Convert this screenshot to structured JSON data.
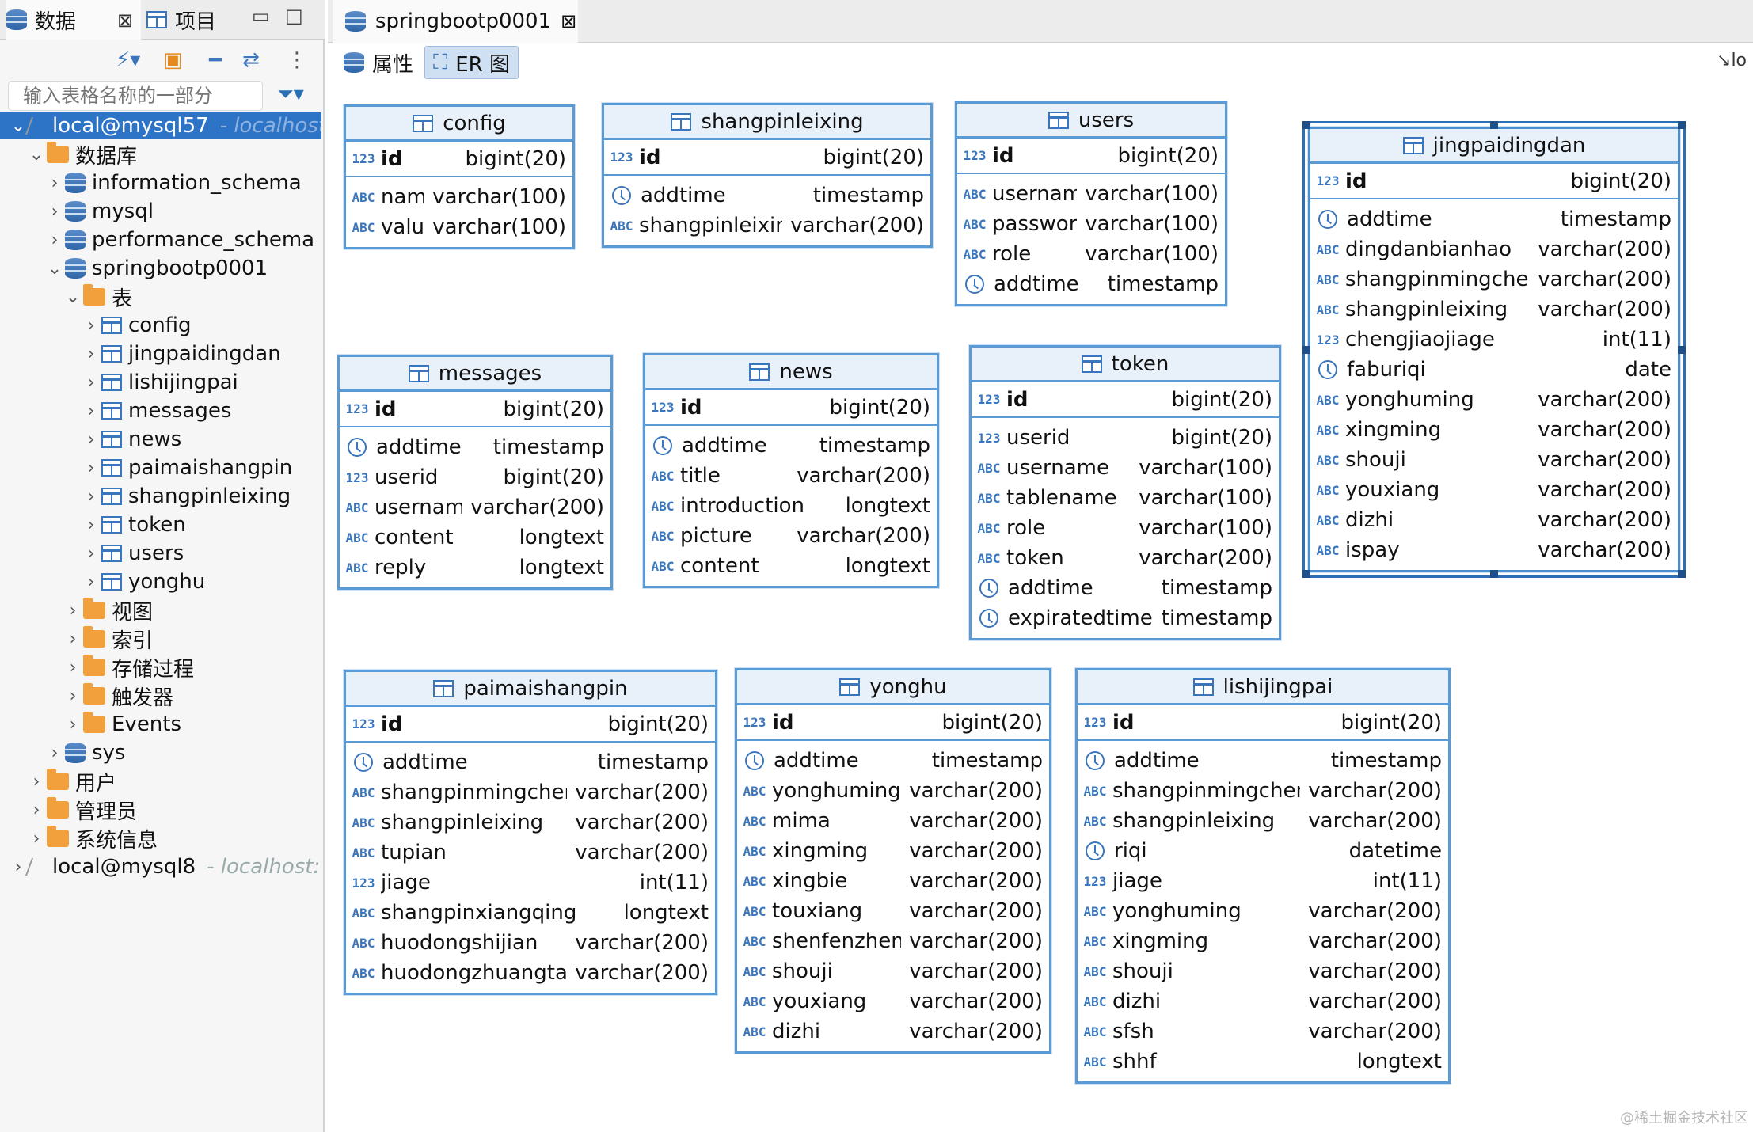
{
  "left_panel": {
    "tab_data_label": "数据",
    "tab_project_label": "项目",
    "filter_placeholder": "输入表格名称的一部分",
    "tree": [
      {
        "label": "local@mysql57",
        "extra": "- localhost",
        "level": 0,
        "expanded": true,
        "icon": "connection",
        "selected": true
      },
      {
        "label": "数据库",
        "level": 1,
        "expanded": true,
        "icon": "database-group"
      },
      {
        "label": "information_schema",
        "level": 2,
        "expanded": false,
        "icon": "database"
      },
      {
        "label": "mysql",
        "level": 2,
        "expanded": false,
        "icon": "database"
      },
      {
        "label": "performance_schema",
        "level": 2,
        "expanded": false,
        "icon": "database"
      },
      {
        "label": "springbootp0001",
        "level": 2,
        "expanded": true,
        "icon": "database"
      },
      {
        "label": "表",
        "level": 3,
        "expanded": true,
        "icon": "table-group"
      },
      {
        "label": "config",
        "level": 4,
        "expanded": false,
        "icon": "table"
      },
      {
        "label": "jingpaidingdan",
        "level": 4,
        "expanded": false,
        "icon": "table"
      },
      {
        "label": "lishijingpai",
        "level": 4,
        "expanded": false,
        "icon": "table"
      },
      {
        "label": "messages",
        "level": 4,
        "expanded": false,
        "icon": "table"
      },
      {
        "label": "news",
        "level": 4,
        "expanded": false,
        "icon": "table"
      },
      {
        "label": "paimaishangpin",
        "level": 4,
        "expanded": false,
        "icon": "table"
      },
      {
        "label": "shangpinleixing",
        "level": 4,
        "expanded": false,
        "icon": "table"
      },
      {
        "label": "token",
        "level": 4,
        "expanded": false,
        "icon": "table"
      },
      {
        "label": "users",
        "level": 4,
        "expanded": false,
        "icon": "table"
      },
      {
        "label": "yonghu",
        "level": 4,
        "expanded": false,
        "icon": "table"
      },
      {
        "label": "视图",
        "level": 3,
        "expanded": false,
        "icon": "view-folder"
      },
      {
        "label": "索引",
        "level": 3,
        "expanded": false,
        "icon": "folder"
      },
      {
        "label": "存储过程",
        "level": 3,
        "expanded": false,
        "icon": "folder"
      },
      {
        "label": "触发器",
        "level": 3,
        "expanded": false,
        "icon": "folder"
      },
      {
        "label": "Events",
        "level": 3,
        "expanded": false,
        "icon": "folder"
      },
      {
        "label": "sys",
        "level": 2,
        "expanded": false,
        "icon": "database"
      },
      {
        "label": "用户",
        "level": 1,
        "expanded": false,
        "icon": "users-folder"
      },
      {
        "label": "管理员",
        "level": 1,
        "expanded": false,
        "icon": "admin-folder"
      },
      {
        "label": "系统信息",
        "level": 1,
        "expanded": false,
        "icon": "info-folder"
      },
      {
        "label": "local@mysql8",
        "extra": "- localhost:",
        "level": 0,
        "expanded": false,
        "icon": "connection"
      }
    ]
  },
  "editor": {
    "tab_title": "springbootp0001",
    "subtab_props": "属性",
    "subtab_er": "ER 图",
    "right_tool_label": "lo"
  },
  "watermark": "@稀土掘金技术社区",
  "entities": [
    {
      "name": "config",
      "pk": {
        "name": "id",
        "type": "bigint(20)"
      },
      "columns": [
        {
          "name": "name",
          "type": "varchar(100)",
          "kind": "text"
        },
        {
          "name": "value",
          "type": "varchar(100)",
          "kind": "text"
        }
      ]
    },
    {
      "name": "shangpinleixing",
      "pk": {
        "name": "id",
        "type": "bigint(20)"
      },
      "columns": [
        {
          "name": "addtime",
          "type": "timestamp",
          "kind": "time"
        },
        {
          "name": "shangpinleixing",
          "type": "varchar(200)",
          "kind": "text"
        }
      ]
    },
    {
      "name": "users",
      "pk": {
        "name": "id",
        "type": "bigint(20)"
      },
      "columns": [
        {
          "name": "username",
          "type": "varchar(100)",
          "kind": "text"
        },
        {
          "name": "password",
          "type": "varchar(100)",
          "kind": "text"
        },
        {
          "name": "role",
          "type": "varchar(100)",
          "kind": "text"
        },
        {
          "name": "addtime",
          "type": "timestamp",
          "kind": "time"
        }
      ]
    },
    {
      "name": "jingpaidingdan",
      "pk": {
        "name": "id",
        "type": "bigint(20)"
      },
      "columns": [
        {
          "name": "addtime",
          "type": "timestamp",
          "kind": "time"
        },
        {
          "name": "dingdanbianhao",
          "type": "varchar(200)",
          "kind": "key-text"
        },
        {
          "name": "shangpinmingcheng",
          "type": "varchar(200)",
          "kind": "text"
        },
        {
          "name": "shangpinleixing",
          "type": "varchar(200)",
          "kind": "text"
        },
        {
          "name": "chengjiaojiage",
          "type": "int(11)",
          "kind": "number"
        },
        {
          "name": "faburiqi",
          "type": "date",
          "kind": "time"
        },
        {
          "name": "yonghuming",
          "type": "varchar(200)",
          "kind": "text"
        },
        {
          "name": "xingming",
          "type": "varchar(200)",
          "kind": "text"
        },
        {
          "name": "shouji",
          "type": "varchar(200)",
          "kind": "text"
        },
        {
          "name": "youxiang",
          "type": "varchar(200)",
          "kind": "text"
        },
        {
          "name": "dizhi",
          "type": "varchar(200)",
          "kind": "text"
        },
        {
          "name": "ispay",
          "type": "varchar(200)",
          "kind": "text"
        }
      ]
    },
    {
      "name": "messages",
      "pk": {
        "name": "id",
        "type": "bigint(20)"
      },
      "columns": [
        {
          "name": "addtime",
          "type": "timestamp",
          "kind": "time"
        },
        {
          "name": "userid",
          "type": "bigint(20)",
          "kind": "number"
        },
        {
          "name": "username",
          "type": "varchar(200)",
          "kind": "text"
        },
        {
          "name": "content",
          "type": "longtext",
          "kind": "text"
        },
        {
          "name": "reply",
          "type": "longtext",
          "kind": "text"
        }
      ]
    },
    {
      "name": "news",
      "pk": {
        "name": "id",
        "type": "bigint(20)"
      },
      "columns": [
        {
          "name": "addtime",
          "type": "timestamp",
          "kind": "time"
        },
        {
          "name": "title",
          "type": "varchar(200)",
          "kind": "text"
        },
        {
          "name": "introduction",
          "type": "longtext",
          "kind": "text"
        },
        {
          "name": "picture",
          "type": "varchar(200)",
          "kind": "text"
        },
        {
          "name": "content",
          "type": "longtext",
          "kind": "text"
        }
      ]
    },
    {
      "name": "token",
      "pk": {
        "name": "id",
        "type": "bigint(20)"
      },
      "columns": [
        {
          "name": "userid",
          "type": "bigint(20)",
          "kind": "number"
        },
        {
          "name": "username",
          "type": "varchar(100)",
          "kind": "text"
        },
        {
          "name": "tablename",
          "type": "varchar(100)",
          "kind": "text"
        },
        {
          "name": "role",
          "type": "varchar(100)",
          "kind": "text"
        },
        {
          "name": "token",
          "type": "varchar(200)",
          "kind": "text"
        },
        {
          "name": "addtime",
          "type": "timestamp",
          "kind": "time"
        },
        {
          "name": "expiratedtime",
          "type": "timestamp",
          "kind": "time"
        }
      ]
    },
    {
      "name": "paimaishangpin",
      "pk": {
        "name": "id",
        "type": "bigint(20)"
      },
      "columns": [
        {
          "name": "addtime",
          "type": "timestamp",
          "kind": "time"
        },
        {
          "name": "shangpinmingcheng",
          "type": "varchar(200)",
          "kind": "text"
        },
        {
          "name": "shangpinleixing",
          "type": "varchar(200)",
          "kind": "text"
        },
        {
          "name": "tupian",
          "type": "varchar(200)",
          "kind": "text"
        },
        {
          "name": "jiage",
          "type": "int(11)",
          "kind": "number"
        },
        {
          "name": "shangpinxiangqing",
          "type": "longtext",
          "kind": "text"
        },
        {
          "name": "huodongshijian",
          "type": "varchar(200)",
          "kind": "text"
        },
        {
          "name": "huodongzhuangtai",
          "type": "varchar(200)",
          "kind": "text"
        }
      ]
    },
    {
      "name": "yonghu",
      "pk": {
        "name": "id",
        "type": "bigint(20)"
      },
      "columns": [
        {
          "name": "addtime",
          "type": "timestamp",
          "kind": "time"
        },
        {
          "name": "yonghuming",
          "type": "varchar(200)",
          "kind": "key-text"
        },
        {
          "name": "mima",
          "type": "varchar(200)",
          "kind": "text"
        },
        {
          "name": "xingming",
          "type": "varchar(200)",
          "kind": "text"
        },
        {
          "name": "xingbie",
          "type": "varchar(200)",
          "kind": "text"
        },
        {
          "name": "touxiang",
          "type": "varchar(200)",
          "kind": "text"
        },
        {
          "name": "shenfenzheng",
          "type": "varchar(200)",
          "kind": "text"
        },
        {
          "name": "shouji",
          "type": "varchar(200)",
          "kind": "text"
        },
        {
          "name": "youxiang",
          "type": "varchar(200)",
          "kind": "text"
        },
        {
          "name": "dizhi",
          "type": "varchar(200)",
          "kind": "text"
        }
      ]
    },
    {
      "name": "lishijingpai",
      "pk": {
        "name": "id",
        "type": "bigint(20)"
      },
      "columns": [
        {
          "name": "addtime",
          "type": "timestamp",
          "kind": "time"
        },
        {
          "name": "shangpinmingcheng",
          "type": "varchar(200)",
          "kind": "text"
        },
        {
          "name": "shangpinleixing",
          "type": "varchar(200)",
          "kind": "text"
        },
        {
          "name": "riqi",
          "type": "datetime",
          "kind": "time"
        },
        {
          "name": "jiage",
          "type": "int(11)",
          "kind": "number"
        },
        {
          "name": "yonghuming",
          "type": "varchar(200)",
          "kind": "text"
        },
        {
          "name": "xingming",
          "type": "varchar(200)",
          "kind": "text"
        },
        {
          "name": "shouji",
          "type": "varchar(200)",
          "kind": "text"
        },
        {
          "name": "dizhi",
          "type": "varchar(200)",
          "kind": "text"
        },
        {
          "name": "sfsh",
          "type": "varchar(200)",
          "kind": "text"
        },
        {
          "name": "shhf",
          "type": "longtext",
          "kind": "text"
        }
      ]
    }
  ]
}
